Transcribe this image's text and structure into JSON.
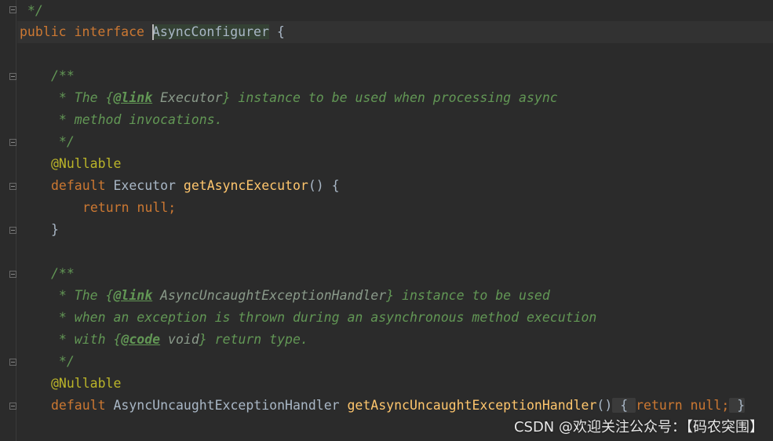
{
  "code": {
    "l0": " */",
    "l1_kw_public": "public",
    "l1_kw_interface": "interface",
    "l1_name": "AsyncConfigurer",
    "l1_brace": " {",
    "l3": "/**",
    "l4_a": " * The ",
    "l4_b": "{",
    "l4_tag": "@link",
    "l4_c": " Executor",
    "l4_d": "}",
    "l4_e": " instance to be used when processing async",
    "l5": " * method invocations.",
    "l6": " */",
    "l7": "@Nullable",
    "l8_kw": "default",
    "l8_type": " Executor ",
    "l8_fn": "getAsyncExecutor",
    "l8_rest": "() {",
    "l9_kw1": "return",
    "l9_kw2": " null;",
    "l10": "}",
    "l12": "/**",
    "l13_a": " * The ",
    "l13_b": "{",
    "l13_tag": "@link",
    "l13_c": " AsyncUncaughtExceptionHandler",
    "l13_d": "}",
    "l13_e": " instance to be used",
    "l14": " * when an exception is thrown during an asynchronous method execution",
    "l15_a": " * with ",
    "l15_b": "{",
    "l15_tag": "@code",
    "l15_c": " void",
    "l15_d": "}",
    "l15_e": " return type.",
    "l16": " */",
    "l17": "@Nullable",
    "l18_kw": "default",
    "l18_type": " AsyncUncaughtExceptionHandler ",
    "l18_fn": "getAsyncUncaughtExceptionHandler",
    "l18_paren": "()",
    "l18_fold_open": " { ",
    "l18_ret": "return",
    "l18_null": " null;",
    "l18_fold_close": " }"
  },
  "watermark": "CSDN @欢迎关注公众号：【码农突围】",
  "colors": {
    "background": "#2b2b2b",
    "keyword": "#cc7832",
    "method": "#ffc66d",
    "annotation": "#bbb529",
    "doc_comment": "#629755",
    "text": "#a9b7c6"
  }
}
